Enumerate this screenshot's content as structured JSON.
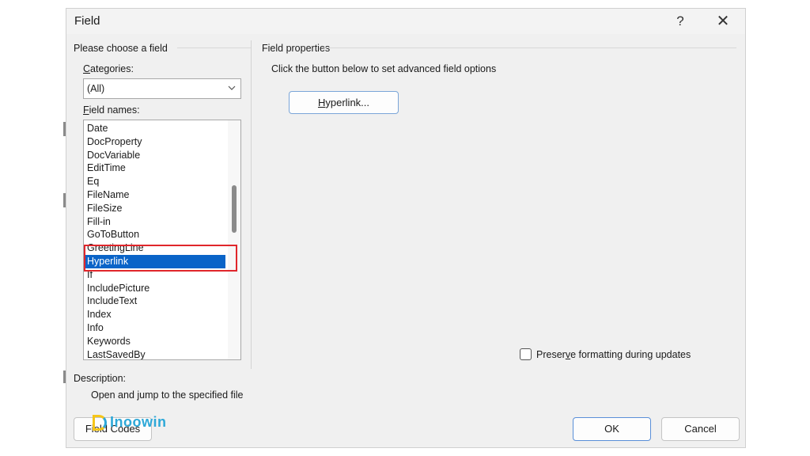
{
  "dialog": {
    "title": "Field",
    "help_glyph": "?",
    "close_glyph": "✕"
  },
  "left_panel": {
    "heading": "Please choose a field",
    "categories_label_accel": "C",
    "categories_label_rest": "ategories:",
    "categories_value": "(All)",
    "field_names_label_accel": "F",
    "field_names_label_rest": "ield names:",
    "field_names": [
      "Date",
      "DocProperty",
      "DocVariable",
      "EditTime",
      "Eq",
      "FileName",
      "FileSize",
      "Fill-in",
      "GoToButton",
      "GreetingLine",
      "Hyperlink",
      "If",
      "IncludePicture",
      "IncludeText",
      "Index",
      "Info",
      "Keywords",
      "LastSavedBy"
    ],
    "selected_field": "Hyperlink"
  },
  "right_panel": {
    "heading": "Field properties",
    "instruction": "Click the button below to set advanced field options",
    "hyperlink_button_accel": "H",
    "hyperlink_button_rest": "yperlink...",
    "preserve_label_pre": "Preser",
    "preserve_label_accel": "v",
    "preserve_label_post": "e formatting during updates",
    "preserve_checked": false
  },
  "description": {
    "label": "Description:",
    "text": "Open and jump to the specified file"
  },
  "footer": {
    "field_codes_label": "Field Codes",
    "ok_label": "OK",
    "cancel_label": "Cancel"
  },
  "watermark": {
    "text": "Inoowin"
  },
  "colors": {
    "selection": "#0a64c8",
    "highlight_border": "#e0262b",
    "watermark": "#2da8d8"
  }
}
